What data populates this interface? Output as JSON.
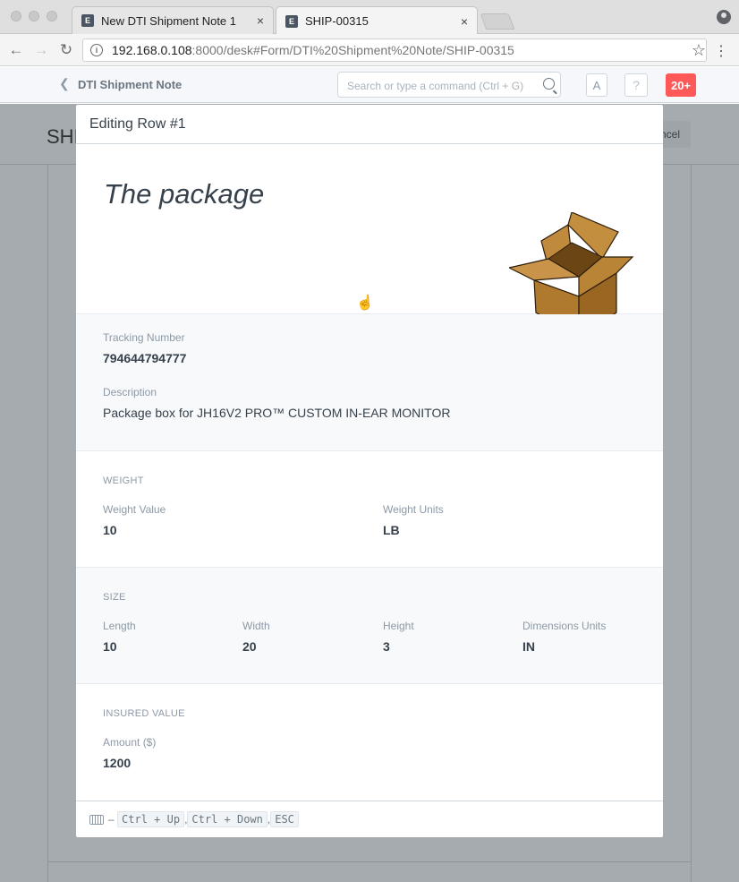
{
  "browser": {
    "tabs": [
      {
        "favicon": "E",
        "title": "New DTI Shipment Note 1",
        "active": false
      },
      {
        "favicon": "E",
        "title": "SHIP-00315",
        "active": true
      }
    ],
    "url_host": "192.168.0.108",
    "url_path": ":8000/desk#Form/DTI%20Shipment%20Note/SHIP-00315"
  },
  "navbar": {
    "back_title": "DTI Shipment Note",
    "search_placeholder": "Search or type a command (Ctrl + G)",
    "avatar_letter": "A",
    "help_label": "?",
    "notification_count": "20+"
  },
  "background": {
    "title": "SHI",
    "cancel_label": "ncel"
  },
  "modal": {
    "header": "Editing Row #1",
    "hero_title": "The package",
    "tracking": {
      "label": "Tracking Number",
      "value": "794644794777"
    },
    "description": {
      "label": "Description",
      "value": "Package box for JH16V2 PRO™ CUSTOM IN-EAR MONITOR"
    },
    "weight": {
      "heading": "WEIGHT",
      "value_label": "Weight Value",
      "value": "10",
      "units_label": "Weight Units",
      "units": "LB"
    },
    "size": {
      "heading": "SIZE",
      "length_label": "Length",
      "length": "10",
      "width_label": "Width",
      "width": "20",
      "height_label": "Height",
      "height": "3",
      "units_label": "Dimensions Units",
      "units": "IN"
    },
    "insured": {
      "heading": "INSURED VALUE",
      "amount_label": "Amount ($)",
      "amount": "1200"
    },
    "footer": {
      "separator": "–",
      "shortcut_1": "Ctrl + Up",
      "comma_1": ",",
      "shortcut_2": "Ctrl + Down",
      "comma_2": ",",
      "shortcut_3": "ESC"
    }
  },
  "colors": {
    "notification": "#ff5858",
    "overlay": "#a5abae",
    "box_brown": "#b07a2e"
  }
}
